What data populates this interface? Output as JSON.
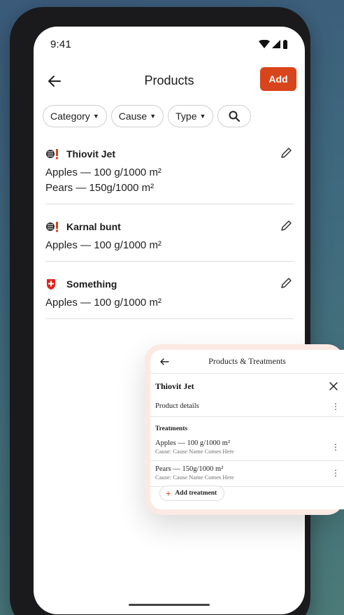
{
  "status_bar": {
    "time": "9:41"
  },
  "header": {
    "title": "Products",
    "add_label": "Add"
  },
  "filters": [
    {
      "label": "Category"
    },
    {
      "label": "Cause"
    },
    {
      "label": "Type"
    }
  ],
  "products": [
    {
      "name": "Thiovit Jet",
      "flag": "germany-flag-icon",
      "lines": [
        "Apples — 100 g/1000 m²",
        "Pears — 150g/1000 m²"
      ]
    },
    {
      "name": "Karnal bunt",
      "flag": "germany-flag-icon",
      "lines": [
        "Apples — 100 g/1000 m²"
      ]
    },
    {
      "name": "Something",
      "flag": "switzerland-flag-icon",
      "lines": [
        "Apples — 100 g/1000 m²"
      ]
    }
  ],
  "overlay": {
    "title": "Products & Treatments",
    "product_name": "Thiovit Jet",
    "product_details_label": "Product details",
    "treatments_label": "Treatments",
    "treatments": [
      {
        "main": "Apples — 100 g/1000 m²",
        "cause": "Cause: Cause Name Comes Here"
      },
      {
        "main": "Pears — 150g/1000 m²",
        "cause": "Cause: Cause Name Comes Here"
      }
    ],
    "add_treatment_label": "Add treatment"
  },
  "colors": {
    "accent": "#d8441b",
    "background_start": "#3b5a7a",
    "background_end": "#4b7a78"
  }
}
